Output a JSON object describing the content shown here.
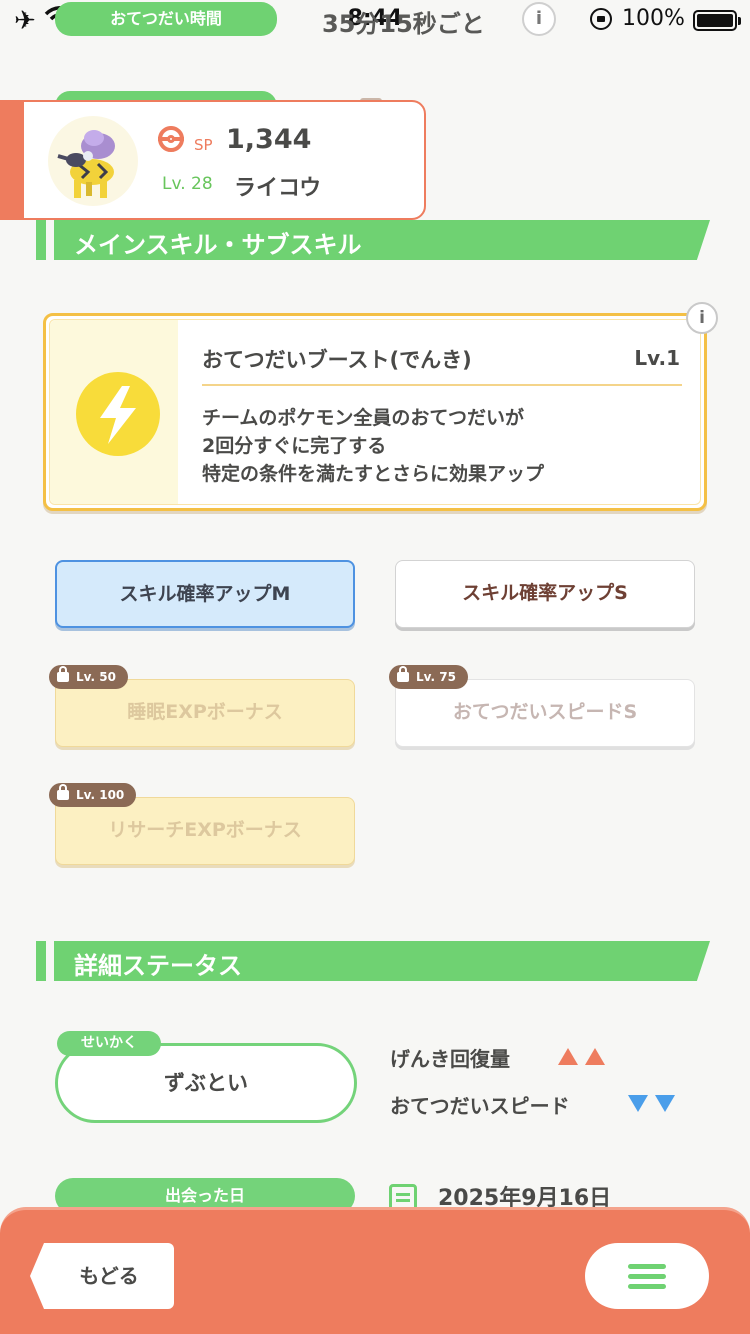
{
  "status_bar": {
    "time": "8:44",
    "battery_percent": "100%"
  },
  "background_header": {
    "help_time_label": "おてつだい時間",
    "interval_text": "35分15秒ごと",
    "info_icon": "i"
  },
  "pokemon": {
    "sp_label": "SP",
    "sp_value": "1,344",
    "level_label": "Lv. 28",
    "name": "ライコウ"
  },
  "sections": {
    "skills_title": "メインスキル・サブスキル",
    "details_title": "詳細ステータス"
  },
  "main_skill": {
    "name": "おてつだいブースト(でんき)",
    "level": "Lv.1",
    "description": [
      "チームのポケモン全員のおてつだいが",
      "2回分すぐに完了する",
      "特定の条件を満たすとさらに効果アップ"
    ],
    "info_icon": "i",
    "icon": "lightning-icon"
  },
  "sub_skills": [
    {
      "label": "スキル確率アップM",
      "state": "selected"
    },
    {
      "label": "スキル確率アップS",
      "state": "unlocked"
    },
    {
      "label": "睡眠EXPボーナス",
      "state": "locked",
      "unlock_level": "Lv. 50"
    },
    {
      "label": "おてつだいスピードS",
      "state": "locked",
      "unlock_level": "Lv. 75"
    },
    {
      "label": "リサーチEXPボーナス",
      "state": "locked",
      "unlock_level": "Lv. 100"
    }
  ],
  "nature": {
    "tag": "せいかく",
    "value": "ずぶとい",
    "up_stat": "げんき回復量",
    "down_stat": "おてつだいスピード"
  },
  "met": {
    "label": "出会った日",
    "date": "2025年9月16日"
  },
  "bottom_bar": {
    "back_label": "もどる",
    "menu_icon": "hamburger-menu-icon"
  },
  "colors": {
    "accent_orange": "#ee7c5e",
    "accent_green": "#6fd272",
    "skill_gold": "#f4c045",
    "selected_blue": "#4e92e1",
    "stat_up": "#ee7c5e",
    "stat_down": "#4a9eea"
  }
}
